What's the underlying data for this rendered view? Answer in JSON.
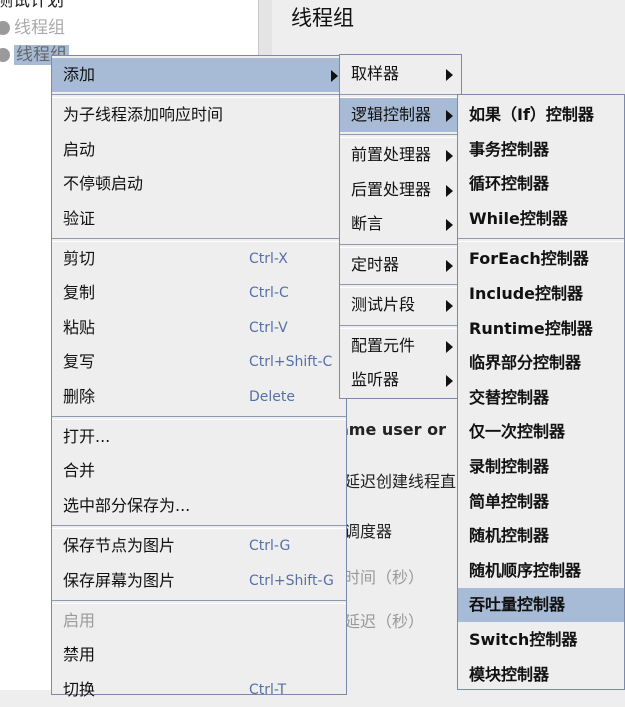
{
  "tree": {
    "root_label": "测试计划",
    "items": [
      {
        "label": "线程组",
        "selected": false
      },
      {
        "label": "线程组",
        "selected": true
      }
    ]
  },
  "panel": {
    "title": "线程组",
    "fragments": [
      "ame user or",
      "延迟创建线程直",
      "调度器",
      "时间（秒）",
      "延迟（秒）"
    ]
  },
  "main_menu": {
    "items": [
      {
        "label": "添加",
        "submenu": true,
        "highlighted": true
      },
      {
        "sep": true
      },
      {
        "label": "为子线程添加响应时间"
      },
      {
        "label": "启动"
      },
      {
        "label": "不停顿启动"
      },
      {
        "label": "验证"
      },
      {
        "sep": true
      },
      {
        "label": "剪切",
        "shortcut": "Ctrl-X"
      },
      {
        "label": "复制",
        "shortcut": "Ctrl-C"
      },
      {
        "label": "粘贴",
        "shortcut": "Ctrl-V"
      },
      {
        "label": "复写",
        "shortcut": "Ctrl+Shift-C"
      },
      {
        "label": "删除",
        "shortcut": "Delete"
      },
      {
        "sep": true
      },
      {
        "label": "打开..."
      },
      {
        "label": "合并"
      },
      {
        "label": "选中部分保存为..."
      },
      {
        "sep": true
      },
      {
        "label": "保存节点为图片",
        "shortcut": "Ctrl-G"
      },
      {
        "label": "保存屏幕为图片",
        "shortcut": "Ctrl+Shift-G"
      },
      {
        "sep": true
      },
      {
        "label": "启用",
        "disabled": true
      },
      {
        "label": "禁用"
      },
      {
        "label": "切换",
        "shortcut": "Ctrl-T"
      }
    ]
  },
  "add_menu": {
    "items": [
      {
        "label": "取样器",
        "submenu": true
      },
      {
        "sep": true
      },
      {
        "label": "逻辑控制器",
        "submenu": true,
        "highlighted": true
      },
      {
        "sep": true
      },
      {
        "label": "前置处理器",
        "submenu": true
      },
      {
        "label": "后置处理器",
        "submenu": true
      },
      {
        "label": "断言",
        "submenu": true
      },
      {
        "sep": true
      },
      {
        "label": "定时器",
        "submenu": true
      },
      {
        "sep": true
      },
      {
        "label": "测试片段",
        "submenu": true
      },
      {
        "sep": true
      },
      {
        "label": "配置元件",
        "submenu": true
      },
      {
        "label": "监听器",
        "submenu": true
      }
    ]
  },
  "logic_menu": {
    "items": [
      {
        "label": "如果（If）控制器"
      },
      {
        "label": "事务控制器"
      },
      {
        "label": "循环控制器"
      },
      {
        "label": "While控制器"
      },
      {
        "sep": true
      },
      {
        "label": "ForEach控制器"
      },
      {
        "label": "Include控制器"
      },
      {
        "label": "Runtime控制器"
      },
      {
        "label": "临界部分控制器"
      },
      {
        "label": "交替控制器"
      },
      {
        "label": "仅一次控制器"
      },
      {
        "label": "录制控制器"
      },
      {
        "label": "简单控制器"
      },
      {
        "label": "随机控制器"
      },
      {
        "label": "随机顺序控制器"
      },
      {
        "label": "吞吐量控制器",
        "highlighted": true
      },
      {
        "label": "Switch控制器"
      },
      {
        "label": "模块控制器"
      }
    ]
  },
  "colors": {
    "highlight": "#a7bbd6",
    "shortcut": "#5670a8",
    "menu_bg": "#eeeeee",
    "border": "#7a8aa8"
  }
}
